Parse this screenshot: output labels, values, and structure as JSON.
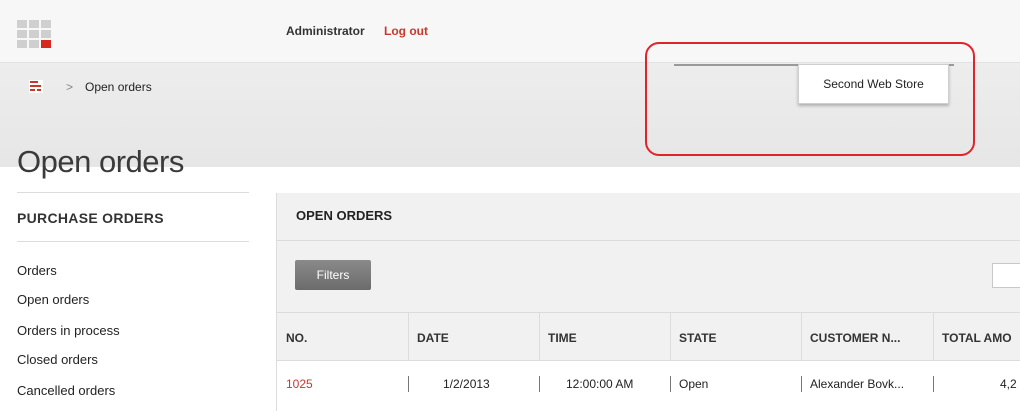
{
  "header": {
    "user_name": "Administrator",
    "logout_label": "Log out"
  },
  "breadcrumb": {
    "separator": ">",
    "current": "Open orders"
  },
  "page": {
    "title": "Open orders"
  },
  "store_selector": {
    "selected": "Second Web Store"
  },
  "sidebar": {
    "heading": "PURCHASE ORDERS",
    "items": [
      "Orders",
      "Open orders",
      "Orders in process",
      "Closed orders",
      "Cancelled orders"
    ]
  },
  "panel": {
    "title": "OPEN ORDERS",
    "filters_label": "Filters"
  },
  "table": {
    "columns": [
      "NO.",
      "DATE",
      "TIME",
      "STATE",
      "CUSTOMER N...",
      "TOTAL AMO"
    ],
    "rows": [
      {
        "no": "1025",
        "date": "1/2/2013",
        "time": "12:00:00 AM",
        "state": "Open",
        "customer": "Alexander Bovk...",
        "total": "4,2"
      }
    ]
  },
  "colors": {
    "accent": "#c7392a",
    "highlight": "#e0242a"
  }
}
